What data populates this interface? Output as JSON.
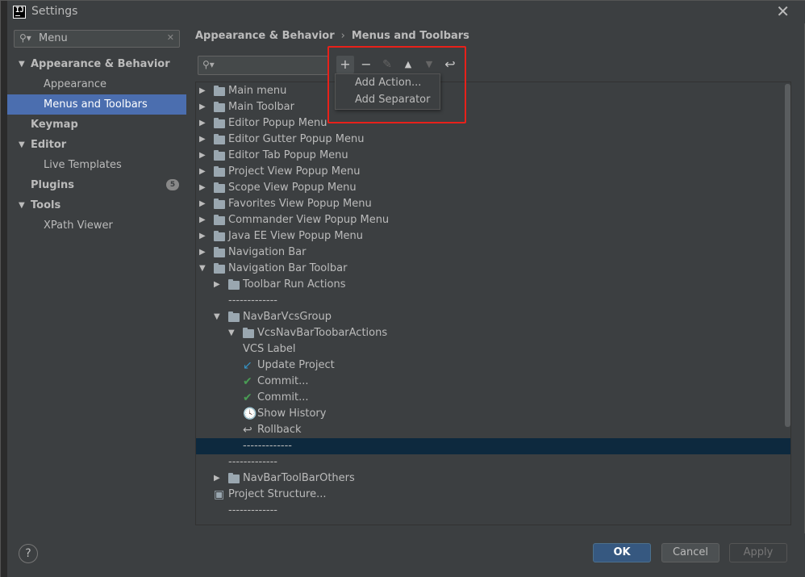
{
  "window": {
    "title": "Settings",
    "close_glyph": "✕"
  },
  "sidebar": {
    "search_value": "Menu",
    "items": [
      {
        "label": "Appearance & Behavior",
        "bold": true,
        "expanded": true
      },
      {
        "label": "Appearance"
      },
      {
        "label": "Menus and Toolbars",
        "selected": true
      },
      {
        "label": "Keymap",
        "bold": true
      },
      {
        "label": "Editor",
        "bold": true,
        "expanded": true
      },
      {
        "label": "Live Templates"
      },
      {
        "label": "Plugins",
        "bold": true,
        "badge": "5"
      },
      {
        "label": "Tools",
        "bold": true,
        "expanded": true
      },
      {
        "label": "XPath Viewer"
      }
    ]
  },
  "breadcrumb": {
    "parent": "Appearance & Behavior",
    "sep": "›",
    "current": "Menus and Toolbars"
  },
  "toolbar": {
    "add": "+",
    "remove": "−",
    "edit": "✎",
    "move_up": "▲",
    "move_down": "▼",
    "restore": "↩"
  },
  "dropdown": {
    "items": [
      "Add Action...",
      "Add Separator"
    ]
  },
  "tree": [
    {
      "label": "Main menu",
      "indent": 0,
      "arrow": "▶",
      "folder": true
    },
    {
      "label": "Main Toolbar",
      "indent": 0,
      "arrow": "▶",
      "folder": true
    },
    {
      "label": "Editor Popup Menu",
      "indent": 0,
      "arrow": "▶",
      "folder": true
    },
    {
      "label": "Editor Gutter Popup Menu",
      "indent": 0,
      "arrow": "▶",
      "folder": true
    },
    {
      "label": "Editor Tab Popup Menu",
      "indent": 0,
      "arrow": "▶",
      "folder": true
    },
    {
      "label": "Project View Popup Menu",
      "indent": 0,
      "arrow": "▶",
      "folder": true
    },
    {
      "label": "Scope View Popup Menu",
      "indent": 0,
      "arrow": "▶",
      "folder": true
    },
    {
      "label": "Favorites View Popup Menu",
      "indent": 0,
      "arrow": "▶",
      "folder": true
    },
    {
      "label": "Commander View Popup Menu",
      "indent": 0,
      "arrow": "▶",
      "folder": true
    },
    {
      "label": "Java EE View Popup Menu",
      "indent": 0,
      "arrow": "▶",
      "folder": true
    },
    {
      "label": "Navigation Bar",
      "indent": 0,
      "arrow": "▶",
      "folder": true
    },
    {
      "label": "Navigation Bar Toolbar",
      "indent": 0,
      "arrow": "▼",
      "folder": true
    },
    {
      "label": "Toolbar Run Actions",
      "indent": 1,
      "arrow": "▶",
      "folder": true
    },
    {
      "label": "-------------",
      "indent": 1,
      "separator": true
    },
    {
      "label": "NavBarVcsGroup",
      "indent": 1,
      "arrow": "▼",
      "folder": true
    },
    {
      "label": "VcsNavBarToobarActions",
      "indent": 2,
      "arrow": "▼",
      "folder": true
    },
    {
      "label": "VCS Label",
      "indent": 3
    },
    {
      "label": "Update Project",
      "indent": 3,
      "icon": "↙",
      "icon_color": "#3592c4"
    },
    {
      "label": "Commit...",
      "indent": 3,
      "icon": "✔",
      "icon_color": "#499c54"
    },
    {
      "label": "Commit...",
      "indent": 3,
      "icon": "✔",
      "icon_color": "#499c54"
    },
    {
      "label": "Show History",
      "indent": 3,
      "icon": "🕓",
      "icon_color": "#bbbbbb"
    },
    {
      "label": "Rollback",
      "indent": 3,
      "icon": "↩",
      "icon_color": "#bbbbbb"
    },
    {
      "label": "-------------",
      "indent": 3,
      "separator": true,
      "selected": true
    },
    {
      "label": "-------------",
      "indent": 1,
      "separator": true
    },
    {
      "label": "NavBarToolBarOthers",
      "indent": 1,
      "arrow": "▶",
      "folder": true
    },
    {
      "label": "Project Structure...",
      "indent": 1,
      "icon": "▣",
      "icon_color": "#9aa7b0"
    },
    {
      "label": "-------------",
      "indent": 1,
      "separator": true
    }
  ],
  "footer": {
    "help": "?",
    "ok": "OK",
    "cancel": "Cancel",
    "apply": "Apply"
  },
  "colors": {
    "selection": "#4b6eaf",
    "tree_selection": "#0d293e",
    "highlight_box": "#e8211a",
    "primary_button": "#365880"
  }
}
